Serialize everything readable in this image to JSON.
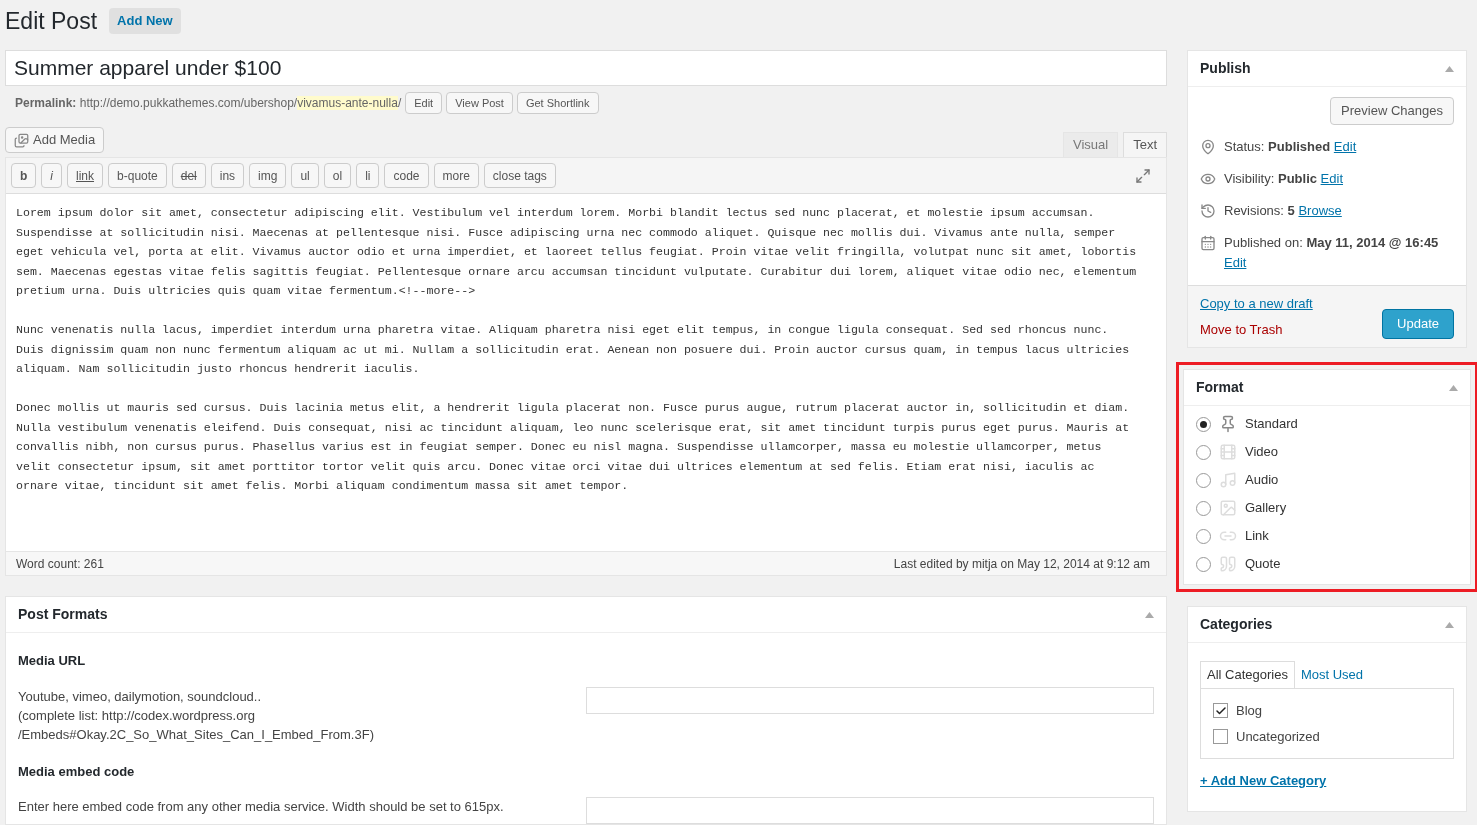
{
  "header": {
    "title": "Edit Post",
    "add_new": "Add New"
  },
  "post_title": "Summer apparel under $100",
  "permalink": {
    "label": "Permalink:",
    "base": "http://demo.pukkathemes.com/ubershop/",
    "slug": "vivamus-ante-nulla",
    "trail": "/",
    "buttons": [
      "Edit",
      "View Post",
      "Get Shortlink"
    ]
  },
  "add_media": "Add Media",
  "editor_tabs": [
    {
      "label": "Visual",
      "selected": false
    },
    {
      "label": "Text",
      "selected": true
    }
  ],
  "quicktags": [
    {
      "label": "b",
      "kind": "bold"
    },
    {
      "label": "i",
      "kind": "italic"
    },
    {
      "label": "link",
      "kind": "underline"
    },
    {
      "label": "b-quote",
      "kind": "plain"
    },
    {
      "label": "del",
      "kind": "strike"
    },
    {
      "label": "ins",
      "kind": "plain"
    },
    {
      "label": "img",
      "kind": "plain"
    },
    {
      "label": "ul",
      "kind": "plain"
    },
    {
      "label": "ol",
      "kind": "plain"
    },
    {
      "label": "li",
      "kind": "plain"
    },
    {
      "label": "code",
      "kind": "plain"
    },
    {
      "label": "more",
      "kind": "plain"
    },
    {
      "label": "close tags",
      "kind": "plain"
    }
  ],
  "content": [
    [
      "Lorem ipsum dolor sit amet, consectetur adipiscing elit. Vestibulum vel interdum lorem. Morbi blandit lectus sed nunc placerat, et molestie ipsum accumsan.",
      "Suspendisse at sollicitudin nisi. Maecenas at pellentesque nisi. Fusce adipiscing urna nec commodo aliquet. Quisque nec mollis dui. Vivamus ante nulla, semper",
      "eget vehicula vel, porta at elit. Vivamus auctor odio et urna imperdiet, et laoreet tellus feugiat. Proin vitae velit fringilla, volutpat nunc sit amet, lobortis",
      "sem. Maecenas egestas vitae felis sagittis feugiat. Pellentesque ornare arcu accumsan tincidunt vulputate. Curabitur dui lorem, aliquet vitae odio nec, elementum",
      "pretium urna. Duis ultricies quis quam vitae fermentum.<!--more-->"
    ],
    [
      "Nunc venenatis nulla lacus, imperdiet interdum urna pharetra vitae. Aliquam pharetra nisi eget elit tempus, in congue ligula consequat. Sed sed rhoncus nunc.",
      "Duis dignissim quam non nunc fermentum aliquam ac ut mi. Nullam a sollicitudin erat. Aenean non posuere dui. Proin auctor cursus quam, in tempus lacus ultricies",
      "aliquam. Nam sollicitudin justo rhoncus hendrerit iaculis."
    ],
    [
      "Donec mollis ut mauris sed cursus. Duis lacinia metus elit, a hendrerit ligula placerat non. Fusce purus augue, rutrum placerat auctor in, sollicitudin et diam.",
      "Nulla vestibulum venenatis eleifend. Duis consequat, nisi ac tincidunt aliquam, leo nunc scelerisque erat, sit amet tincidunt turpis purus eget purus. Mauris at",
      "convallis nibh, non cursus purus. Phasellus varius est in feugiat semper. Donec eu nisl magna. Suspendisse ullamcorper, massa eu molestie ullamcorper, metus",
      "velit consectetur ipsum, sit amet porttitor tortor velit quis arcu. Donec vitae orci vitae dui ultrices elementum at sed felis. Etiam erat nisi, iaculis ac",
      "ornare vitae, tincidunt sit amet felis. Morbi aliquam condimentum massa sit amet tempor."
    ]
  ],
  "status_bar": {
    "word_count": "Word count: 261",
    "last_edited": "Last edited by mitja on May 12, 2014 at 9:12 am"
  },
  "post_formats_box": {
    "title": "Post Formats",
    "fields": [
      {
        "label": "Media URL",
        "description": [
          "Youtube, vimeo, dailymotion, soundcloud..",
          "(complete list: http://codex.wordpress.org",
          "/Embeds#Okay.2C_So_What_Sites_Can_I_Embed_From.3F)"
        ]
      },
      {
        "label": "Media embed code",
        "description": [
          "Enter here embed code from any other media service. Width should be set to 615px."
        ]
      }
    ]
  },
  "publish": {
    "title": "Publish",
    "preview": "Preview Changes",
    "rows": [
      {
        "kind": "status",
        "label": "Status:",
        "value": "Published",
        "link": "Edit"
      },
      {
        "kind": "visibility",
        "label": "Visibility:",
        "value": "Public",
        "link": "Edit"
      },
      {
        "kind": "revisions",
        "label": "Revisions:",
        "value": "5",
        "link": "Browse"
      },
      {
        "kind": "date",
        "label": "Published on:",
        "value": "May 11, 2014 @ 16:45",
        "link": "Edit"
      }
    ],
    "copy_draft": "Copy to a new draft",
    "trash": "Move to Trash",
    "update": "Update"
  },
  "format": {
    "title": "Format",
    "highlighted": true,
    "options": [
      {
        "label": "Standard",
        "kind": "standard",
        "selected": true
      },
      {
        "label": "Video",
        "kind": "video",
        "selected": false
      },
      {
        "label": "Audio",
        "kind": "audio",
        "selected": false
      },
      {
        "label": "Gallery",
        "kind": "gallery",
        "selected": false
      },
      {
        "label": "Link",
        "kind": "link",
        "selected": false
      },
      {
        "label": "Quote",
        "kind": "quote",
        "selected": false
      }
    ]
  },
  "categories": {
    "title": "Categories",
    "tabs": [
      {
        "label": "All Categories",
        "selected": true
      },
      {
        "label": "Most Used",
        "selected": false
      }
    ],
    "items": [
      {
        "label": "Blog",
        "checked": true
      },
      {
        "label": "Uncategorized",
        "checked": false
      }
    ],
    "add_new": "+ Add New Category"
  }
}
